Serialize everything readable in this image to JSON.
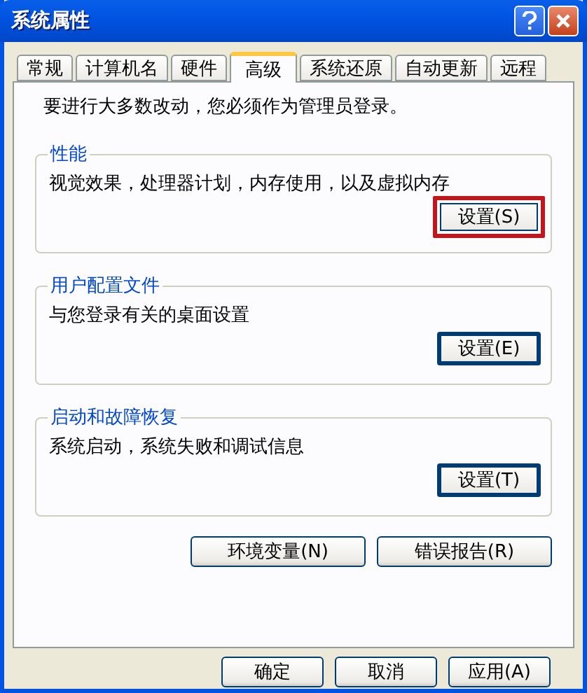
{
  "window": {
    "title": "系统属性"
  },
  "tabs": [
    {
      "label": "常规",
      "selected": false
    },
    {
      "label": "计算机名",
      "selected": false
    },
    {
      "label": "硬件",
      "selected": false
    },
    {
      "label": "高级",
      "selected": true
    },
    {
      "label": "系统还原",
      "selected": false
    },
    {
      "label": "自动更新",
      "selected": false
    },
    {
      "label": "远程",
      "selected": false
    }
  ],
  "notice": "要进行大多数改动，您必须作为管理员登录。",
  "groups": [
    {
      "title": "性能",
      "description": "视觉效果，处理器计划，内存使用，以及虚拟内存",
      "button": {
        "label": "设置(S)",
        "highlighted": true
      }
    },
    {
      "title": "用户配置文件",
      "description": "与您登录有关的桌面设置",
      "button": {
        "label": "设置(E)",
        "highlighted": false
      }
    },
    {
      "title": "启动和故障恢复",
      "description": "系统启动，系统失败和调试信息",
      "button": {
        "label": "设置(T)",
        "highlighted": false
      }
    }
  ],
  "extra_buttons": [
    "环境变量(N)",
    "错误报告(R)"
  ],
  "dialog_buttons": [
    "确定",
    "取消",
    "应用(A)"
  ]
}
